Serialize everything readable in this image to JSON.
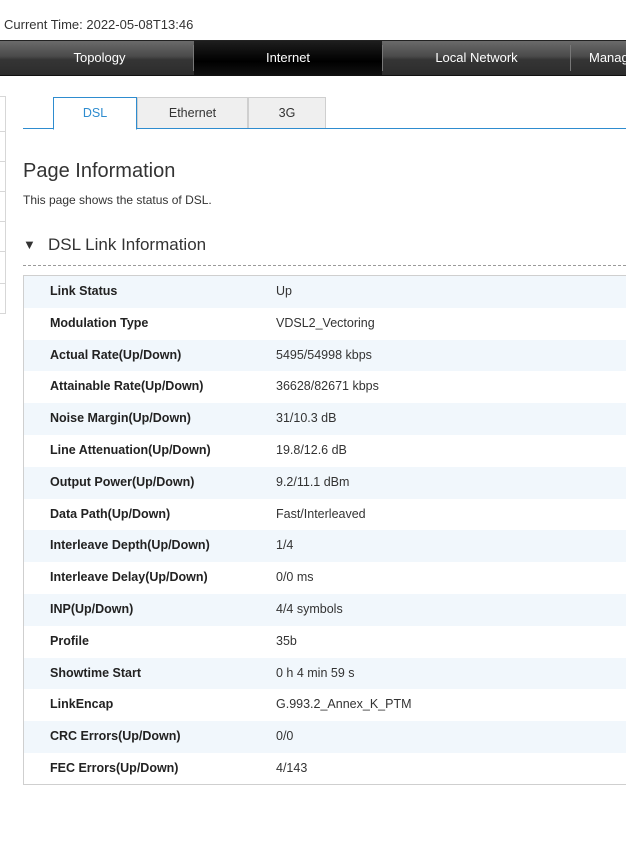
{
  "header": {
    "current_time": "Current Time: 2022-05-08T13:46"
  },
  "nav": {
    "items": [
      {
        "label": "Topology"
      },
      {
        "label": "Internet",
        "active": true
      },
      {
        "label": "Local Network"
      },
      {
        "label": "Manag"
      }
    ]
  },
  "tabs": [
    {
      "label": "DSL",
      "active": true
    },
    {
      "label": "Ethernet"
    },
    {
      "label": "3G"
    }
  ],
  "page": {
    "title": "Page Information",
    "description": "This page shows the status of DSL."
  },
  "section": {
    "toggle_icon": "▼",
    "title": "DSL Link Information"
  },
  "dsl_info": [
    {
      "label": "Link Status",
      "value": "Up"
    },
    {
      "label": "Modulation Type",
      "value": "VDSL2_Vectoring"
    },
    {
      "label": "Actual Rate(Up/Down)",
      "value": "5495/54998 kbps"
    },
    {
      "label": "Attainable Rate(Up/Down)",
      "value": "36628/82671 kbps"
    },
    {
      "label": "Noise Margin(Up/Down)",
      "value": "31/10.3 dB"
    },
    {
      "label": "Line Attenuation(Up/Down)",
      "value": "19.8/12.6 dB"
    },
    {
      "label": "Output Power(Up/Down)",
      "value": "9.2/11.1 dBm"
    },
    {
      "label": "Data Path(Up/Down)",
      "value": "Fast/Interleaved"
    },
    {
      "label": "Interleave Depth(Up/Down)",
      "value": "1/4"
    },
    {
      "label": "Interleave Delay(Up/Down)",
      "value": "0/0 ms"
    },
    {
      "label": "INP(Up/Down)",
      "value": "4/4 symbols"
    },
    {
      "label": "Profile",
      "value": "35b"
    },
    {
      "label": "Showtime Start",
      "value": "0 h 4 min 59 s"
    },
    {
      "label": "LinkEncap",
      "value": "G.993.2_Annex_K_PTM"
    },
    {
      "label": "CRC Errors(Up/Down)",
      "value": "0/0"
    },
    {
      "label": "FEC Errors(Up/Down)",
      "value": "4/143"
    }
  ],
  "colors": {
    "accent": "#2e8ccf",
    "row_shade": "#f1f7fc",
    "nav_bg": "#3a3a3a"
  }
}
